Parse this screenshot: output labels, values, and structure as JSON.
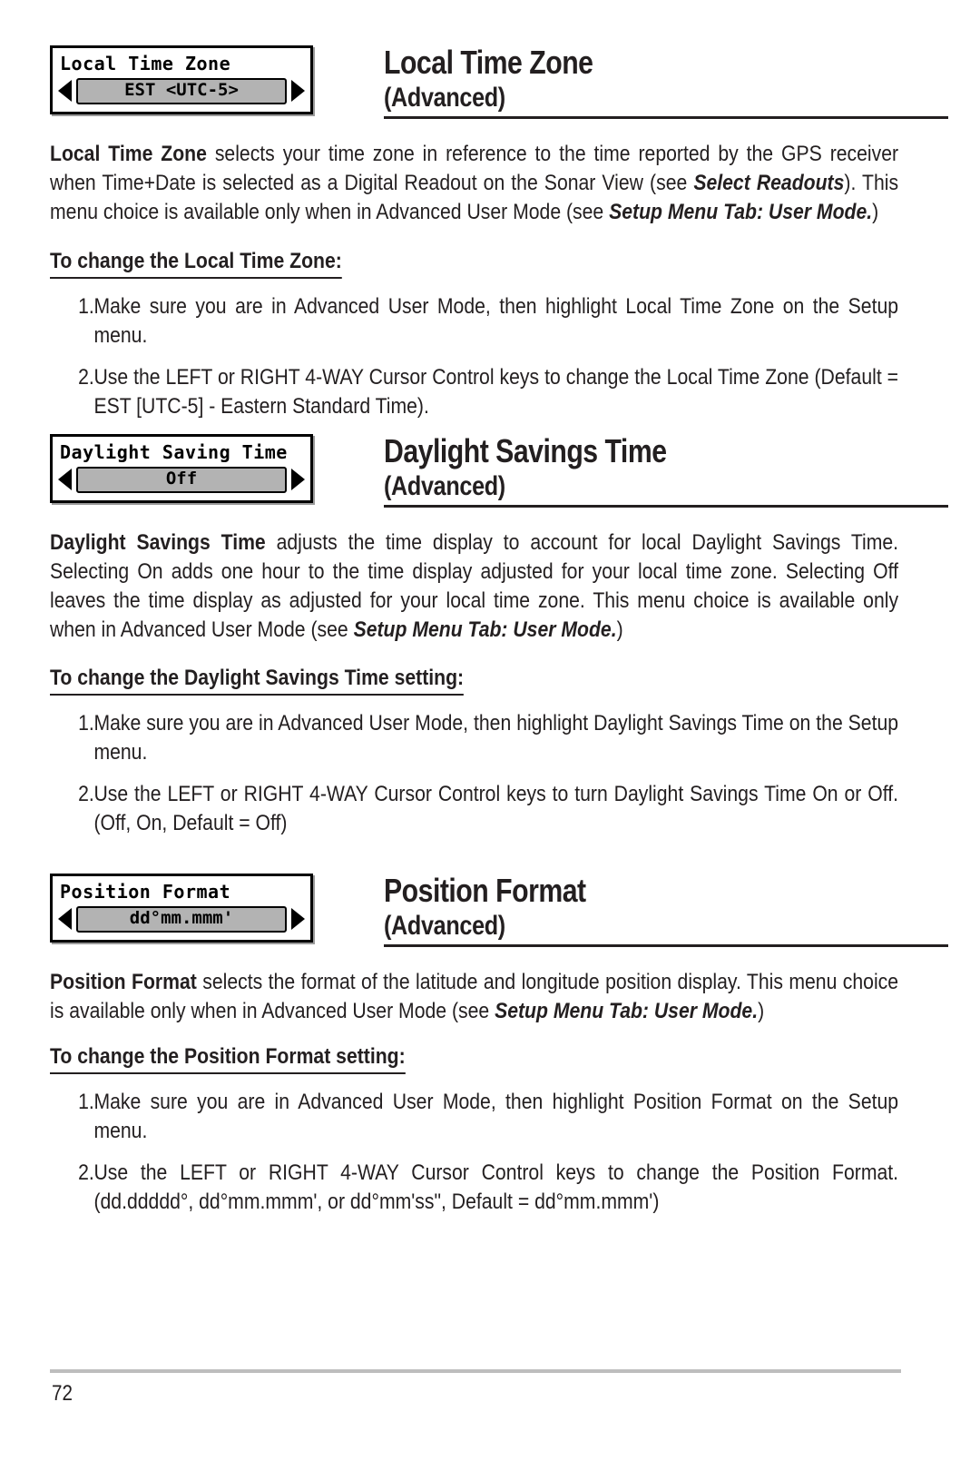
{
  "page": {
    "number": "72"
  },
  "sections": [
    {
      "id": "local-time-zone",
      "menu": {
        "title": "Local Time Zone",
        "value": "EST <UTC-5>",
        "left_arrow": "left-arrow-icon",
        "right_arrow": "right-arrow-icon"
      },
      "heading": "Local Time Zone",
      "subheading": "(Advanced)",
      "body_html": "<b>Local Time Zone</b> selects your time zone in reference to the time reported by the GPS receiver when Time+Date is selected as a Digital Readout on the Sonar View (see <i>Select Readouts</i>).  This menu choice is available only when in Advanced User Mode (see <i>Setup Menu Tab: User Mode.</i>)",
      "subhead": "To change the Local Time Zone:",
      "steps": [
        {
          "num": "1.",
          "text": "Make sure you are in Advanced User Mode, then highlight Local Time Zone on the Setup menu."
        },
        {
          "num": "2.",
          "text": "Use the LEFT or RIGHT 4-WAY Cursor Control keys to change the Local Time Zone (Default = EST [UTC-5] - Eastern Standard Time)."
        }
      ]
    },
    {
      "id": "daylight-savings-time",
      "menu": {
        "title": "Daylight Saving Time",
        "value": "Off",
        "left_arrow": "left-arrow-icon",
        "right_arrow": "right-arrow-icon"
      },
      "heading": "Daylight Savings Time",
      "subheading": "(Advanced)",
      "body_html": "<b>Daylight Savings Time</b> adjusts the time display to account for local Daylight Savings Time. Selecting On adds one hour to the time display adjusted for your local time zone.  Selecting Off leaves the time display as adjusted for your local time zone. This menu choice is available only when in Advanced User Mode (see <i>Setup Menu Tab: User Mode.</i>)",
      "subhead": "To change the Daylight Savings Time setting:",
      "steps": [
        {
          "num": "1.",
          "text": "Make sure you are in Advanced User Mode, then highlight Daylight Savings Time on the Setup menu."
        },
        {
          "num": "2.",
          "text": "Use the LEFT or RIGHT 4-WAY Cursor Control keys to turn Daylight Savings Time On or Off. (Off, On, Default = Off)"
        }
      ]
    },
    {
      "id": "position-format",
      "menu": {
        "title": "Position Format",
        "value": "dd°mm.mmm'",
        "left_arrow": "left-arrow-icon",
        "right_arrow": "right-arrow-icon"
      },
      "heading": "Position Format",
      "subheading": "(Advanced)",
      "body_html": "<b>Position Format</b> selects the format of the latitude and longitude position display.   This menu choice is available only when in Advanced User Mode (see <i>Setup Menu Tab: User Mode.</i>)",
      "subhead": "To change the Position Format setting:",
      "steps": [
        {
          "num": "1.",
          "text": "Make sure you are in Advanced User Mode, then highlight Position Format on the Setup menu."
        },
        {
          "num": "2.",
          "text": "Use the LEFT or RIGHT 4-WAY Cursor Control keys to change the Position Format. (dd.ddddd°, dd°mm.mmm', or dd°mm'ss\", Default = dd°mm.mmm')"
        }
      ]
    }
  ]
}
